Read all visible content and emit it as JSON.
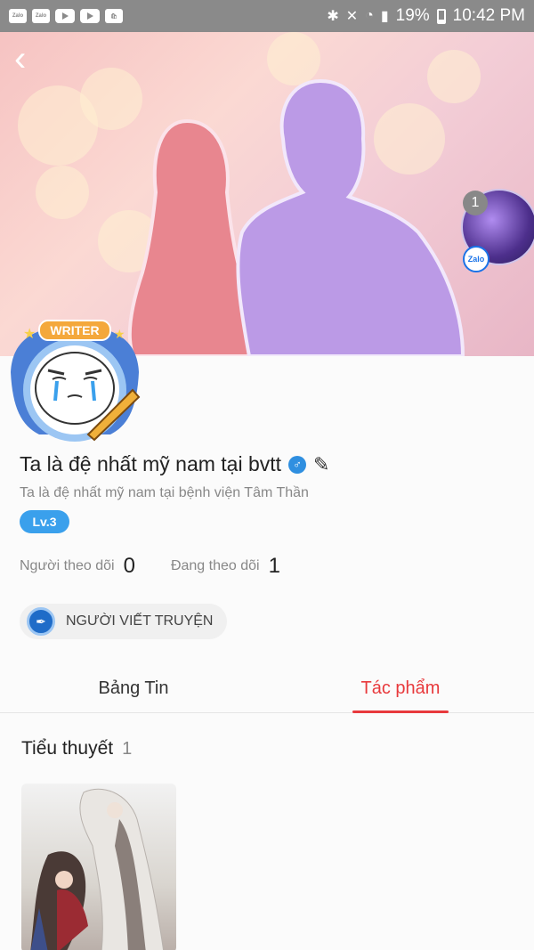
{
  "status_bar": {
    "left_icons": [
      "zalo-app-icon",
      "zalo-app-icon",
      "youtube-icon",
      "youtube-icon",
      "shopping-bag-icon"
    ],
    "app_label": "Zalo",
    "right_icons": [
      "bluetooth-icon",
      "mute-icon",
      "wifi-icon",
      "signal-icon"
    ],
    "battery": "19%",
    "time": "10:42 PM"
  },
  "cover": {
    "back_label": "‹",
    "book_count": "1",
    "zalo_badge": "Zalo"
  },
  "avatar": {
    "badge_label": "WRITER"
  },
  "profile": {
    "name": "Ta là đệ nhất mỹ nam tại bvtt",
    "gender_symbol": "♂",
    "bio": "Ta là đệ nhất mỹ nam tại bệnh viện Tâm Thần",
    "level": "Lv.3",
    "followers_label": "Người theo dõi",
    "followers_count": "0",
    "following_label": "Đang theo dõi",
    "following_count": "1",
    "role_badge": "NGƯỜI VIẾT TRUYỆN"
  },
  "tabs": [
    {
      "label": "Bảng Tin",
      "active": false
    },
    {
      "label": "Tác phẩm",
      "active": true
    }
  ],
  "section": {
    "title": "Tiểu thuyết",
    "count": "1"
  },
  "colors": {
    "accent": "#e8393c",
    "level_blue": "#3aa0ec",
    "status_bar": "#8a8a8a"
  }
}
